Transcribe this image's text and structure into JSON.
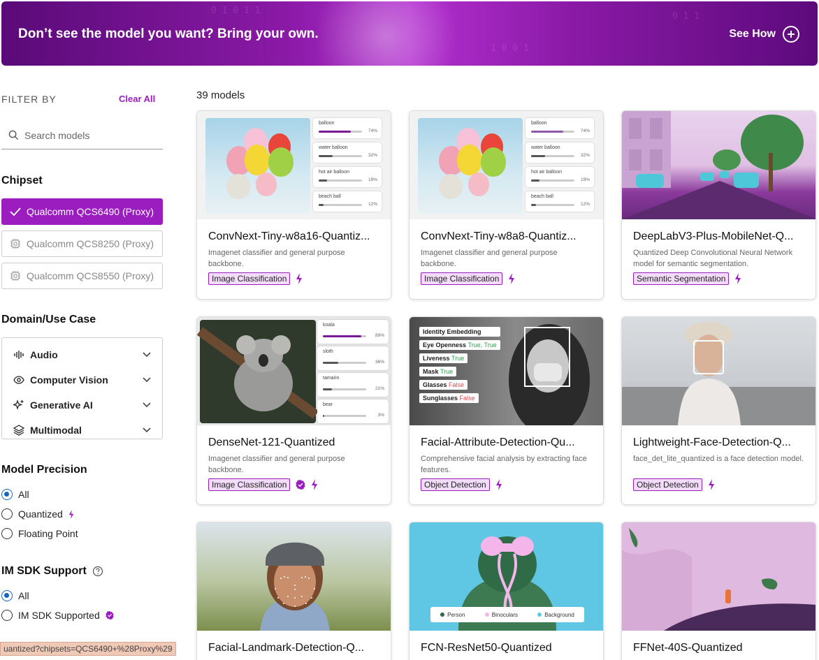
{
  "banner": {
    "title": "Don’t see the model you want? Bring your own.",
    "cta": "See How"
  },
  "sidebar": {
    "filter_by": "FILTER BY",
    "clear_all": "Clear All",
    "search_placeholder": "Search models",
    "chipset_title": "Chipset",
    "chipsets": [
      {
        "label": "Qualcomm QCS6490 (Proxy)",
        "selected": true
      },
      {
        "label": "Qualcomm QCS8250 (Proxy)",
        "selected": false
      },
      {
        "label": "Qualcomm QCS8550 (Proxy)",
        "selected": false
      }
    ],
    "domain_title": "Domain/Use Case",
    "domains": [
      {
        "label": "Audio",
        "icon": "waveform-icon"
      },
      {
        "label": "Computer Vision",
        "icon": "eye-icon"
      },
      {
        "label": "Generative AI",
        "icon": "sparkle-icon"
      },
      {
        "label": "Multimodal",
        "icon": "layers-icon"
      }
    ],
    "precision_title": "Model Precision",
    "precision_options": [
      {
        "label": "All",
        "checked": true
      },
      {
        "label": "Quantized",
        "checked": false
      },
      {
        "label": "Floating Point",
        "checked": false
      }
    ],
    "sdk_title": "IM SDK Support",
    "sdk_options": [
      {
        "label": "All",
        "checked": true
      },
      {
        "label": "IM SDK Supported",
        "checked": false
      }
    ],
    "status_url": "uantized?chipsets=QCS6490+%28Proxy%29"
  },
  "main": {
    "count": "39 models",
    "cards": [
      {
        "title": "ConvNext-Tiny-w8a16-Quantiz...",
        "desc": "Imagenet classifier and general purpose backbone.",
        "tag": "Image Classification",
        "badge": false
      },
      {
        "title": "ConvNext-Tiny-w8a8-Quantiz...",
        "desc": "Imagenet classifier and general purpose backbone.",
        "tag": "Image Classification",
        "badge": false
      },
      {
        "title": "DeepLabV3-Plus-MobileNet-Q...",
        "desc": "Quantized Deep Convolutional Neural Network model for semantic segmentation.",
        "tag": "Semantic Segmentation",
        "badge": false
      },
      {
        "title": "DenseNet-121-Quantized",
        "desc": "Imagenet classifier and general purpose backbone.",
        "tag": "Image Classification",
        "badge": true
      },
      {
        "title": "Facial-Attribute-Detection-Qu...",
        "desc": "Comprehensive facial analysis by extracting face features.",
        "tag": "Object Detection",
        "badge": false
      },
      {
        "title": "Lightweight-Face-Detection-Q...",
        "desc": "face_det_lite_quantized is a face detection model.",
        "tag": "Object Detection",
        "badge": false
      },
      {
        "title": "Facial-Landmark-Detection-Q...",
        "desc": "",
        "tag": "",
        "badge": false
      },
      {
        "title": "FCN-ResNet50-Quantized",
        "desc": "",
        "tag": "",
        "badge": false
      },
      {
        "title": "FFNet-40S-Quantized",
        "desc": "",
        "tag": "",
        "badge": false
      }
    ],
    "balloon_preds": [
      {
        "label": "balloon",
        "pct": "74%",
        "value": 0.74
      },
      {
        "label": "water balloon",
        "pct": "32%",
        "value": 0.32
      },
      {
        "label": "hot air balloon",
        "pct": "19%",
        "value": 0.19
      },
      {
        "label": "beach ball",
        "pct": "12%",
        "value": 0.12
      }
    ],
    "koala_preds": [
      {
        "label": "koala",
        "pct": "89%",
        "value": 0.89
      },
      {
        "label": "sloth",
        "pct": "36%",
        "value": 0.36
      },
      {
        "label": "tamarin",
        "pct": "21%",
        "value": 0.21
      },
      {
        "label": "bear",
        "pct": "3%",
        "value": 0.03
      }
    ],
    "face_attrs": [
      {
        "label": "Identity Embedding",
        "value": ""
      },
      {
        "label": "Eye Openness",
        "value": "True, True"
      },
      {
        "label": "Liveness",
        "value": "True"
      },
      {
        "label": "Mask",
        "value": "True"
      },
      {
        "label": "Glasses",
        "value": "False"
      },
      {
        "label": "Sunglasses",
        "value": "False"
      }
    ],
    "seg_legend": [
      "Person",
      "Binoculars",
      "Background"
    ]
  },
  "colors": {
    "accent": "#9b1dbf",
    "tag_bg": "#f3dcf9",
    "radio": "#1565c0"
  }
}
